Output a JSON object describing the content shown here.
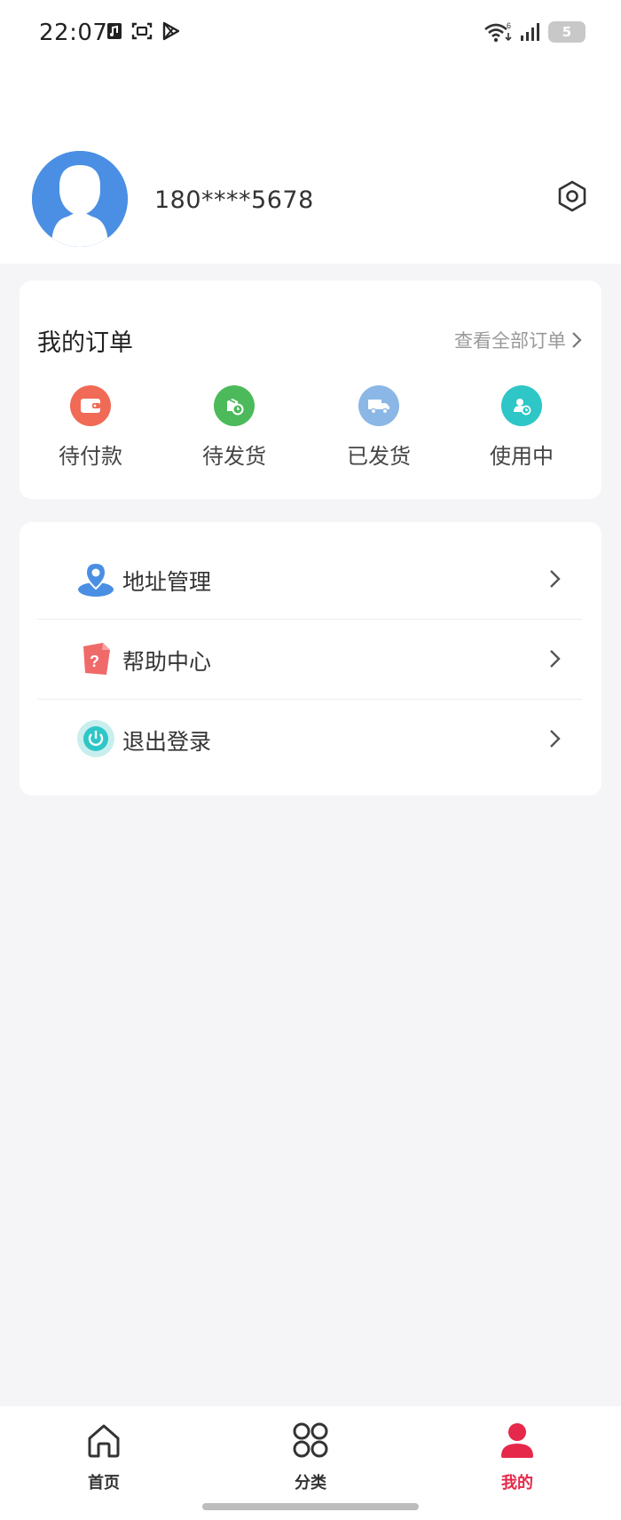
{
  "status_bar": {
    "time": "22:07",
    "battery": "5",
    "network_badge": "6"
  },
  "profile": {
    "phone": "180****5678",
    "avatar_color": "#4a8fe3"
  },
  "orders": {
    "title": "我的订单",
    "view_all": "查看全部订单",
    "items": [
      {
        "label": "待付款",
        "icon": "wallet-icon",
        "color": "#f06a55"
      },
      {
        "label": "待发货",
        "icon": "package-clock-icon",
        "color": "#4cba5a"
      },
      {
        "label": "已发货",
        "icon": "truck-icon",
        "color": "#8bb7e6"
      },
      {
        "label": "使用中",
        "icon": "user-clock-icon",
        "color": "#2ec6c6"
      }
    ]
  },
  "menu": {
    "items": [
      {
        "label": "地址管理",
        "icon": "location-pin-icon",
        "color": "#4a8fe3"
      },
      {
        "label": "帮助中心",
        "icon": "help-question-icon",
        "color": "#f06a6a"
      },
      {
        "label": "退出登录",
        "icon": "power-icon",
        "color": "#2ec6c6"
      }
    ]
  },
  "tabbar": {
    "accent_color": "#e6284a",
    "items": [
      {
        "label": "首页",
        "icon": "home-icon"
      },
      {
        "label": "分类",
        "icon": "grid-icon"
      },
      {
        "label": "我的",
        "icon": "profile-icon",
        "active": true
      }
    ]
  }
}
